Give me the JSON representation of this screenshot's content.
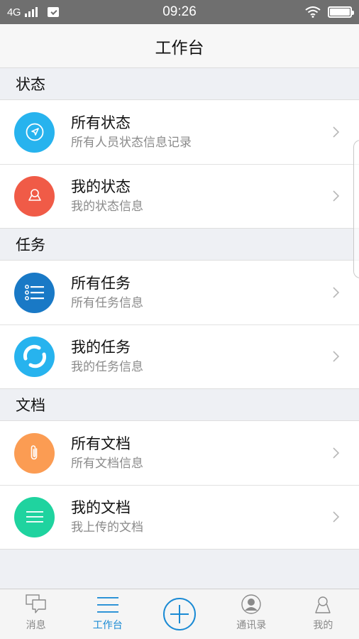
{
  "status_bar": {
    "network": "4G",
    "time": "09:26"
  },
  "header": {
    "title": "工作台"
  },
  "sections": [
    {
      "title": "状态",
      "items": [
        {
          "title": "所有状态",
          "subtitle": "所有人员状态信息记录",
          "icon": "compass-icon",
          "color": "#27b3ee"
        },
        {
          "title": "我的状态",
          "subtitle": "我的状态信息",
          "icon": "person-icon",
          "color": "#f05b47"
        }
      ]
    },
    {
      "title": "任务",
      "items": [
        {
          "title": "所有任务",
          "subtitle": "所有任务信息",
          "icon": "list-icon",
          "color": "#1979c6"
        },
        {
          "title": "我的任务",
          "subtitle": "我的任务信息",
          "icon": "refresh-icon",
          "color": "#27b3ee"
        }
      ]
    },
    {
      "title": "文档",
      "items": [
        {
          "title": "所有文档",
          "subtitle": "所有文档信息",
          "icon": "paperclip-icon",
          "color": "#fb9c53"
        },
        {
          "title": "我的文档",
          "subtitle": "我上传的文档",
          "icon": "menu-lines-icon",
          "color": "#1fd39f"
        }
      ]
    }
  ],
  "tabbar": {
    "tabs": [
      {
        "label": "消息",
        "icon": "chat-icon"
      },
      {
        "label": "工作台",
        "icon": "menu-icon",
        "active": true
      },
      {
        "label": "",
        "icon": "add-icon"
      },
      {
        "label": "通讯录",
        "icon": "contacts-icon"
      },
      {
        "label": "我的",
        "icon": "profile-icon"
      }
    ]
  },
  "colors": {
    "accent": "#1a8ad4",
    "status_bar": "#6f6f6f",
    "background": "#eef0f4"
  }
}
